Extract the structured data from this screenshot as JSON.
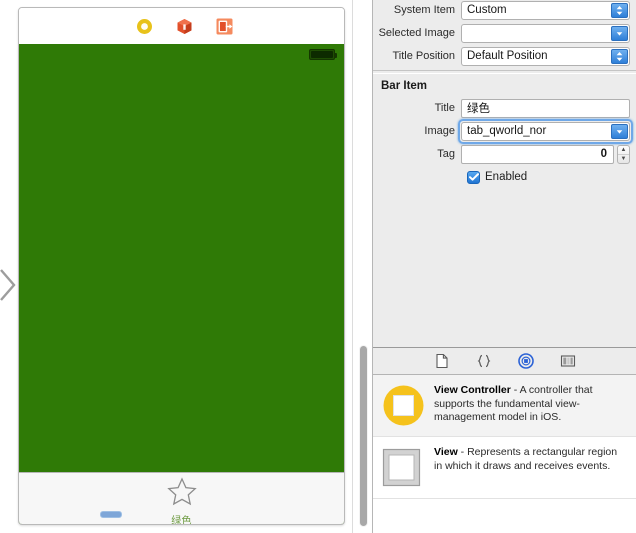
{
  "canvas": {
    "scene_dock_icons": [
      "view-controller-icon",
      "first-responder-icon",
      "exit-segue-icon"
    ],
    "entry_point_icon": "chevron-right-icon",
    "background_color": "#2f7a06",
    "status_bar": {
      "battery_icon": "battery-full-icon"
    },
    "tab_bar": {
      "item_icon": "star-outline-icon",
      "item_label": "绿色",
      "label_color": "#6c9a3f"
    },
    "selection_handle": "resize-handle"
  },
  "inspector": {
    "top_rows": [
      {
        "label": "System Item",
        "value": "Custom",
        "control": "popup-button"
      },
      {
        "label": "Selected Image",
        "value": "",
        "control": "combo-box"
      },
      {
        "label": "Title Position",
        "value": "Default Position",
        "control": "popup-button"
      }
    ],
    "bar_item": {
      "section_title": "Bar Item",
      "title": {
        "label": "Title",
        "value": "绿色"
      },
      "image": {
        "label": "Image",
        "value": "tab_qworld_nor",
        "focused": true
      },
      "tag": {
        "label": "Tag",
        "value": "0"
      },
      "enabled": {
        "label": "Enabled",
        "checked": true
      }
    },
    "accent_color": "#2f7fd8"
  },
  "library": {
    "tabs": [
      {
        "name": "file-template-icon",
        "selected": false
      },
      {
        "name": "code-snippet-icon",
        "selected": false
      },
      {
        "name": "objects-icon",
        "selected": true
      },
      {
        "name": "media-icon",
        "selected": false
      }
    ],
    "items": [
      {
        "title": "View Controller",
        "description": " - A controller that supports the fundamental view-management model in iOS.",
        "thumb": "view-controller-thumb"
      },
      {
        "title": "View",
        "description": " - Represents a rectangular region in which it draws and receives events.",
        "thumb": "view-thumb"
      }
    ]
  }
}
